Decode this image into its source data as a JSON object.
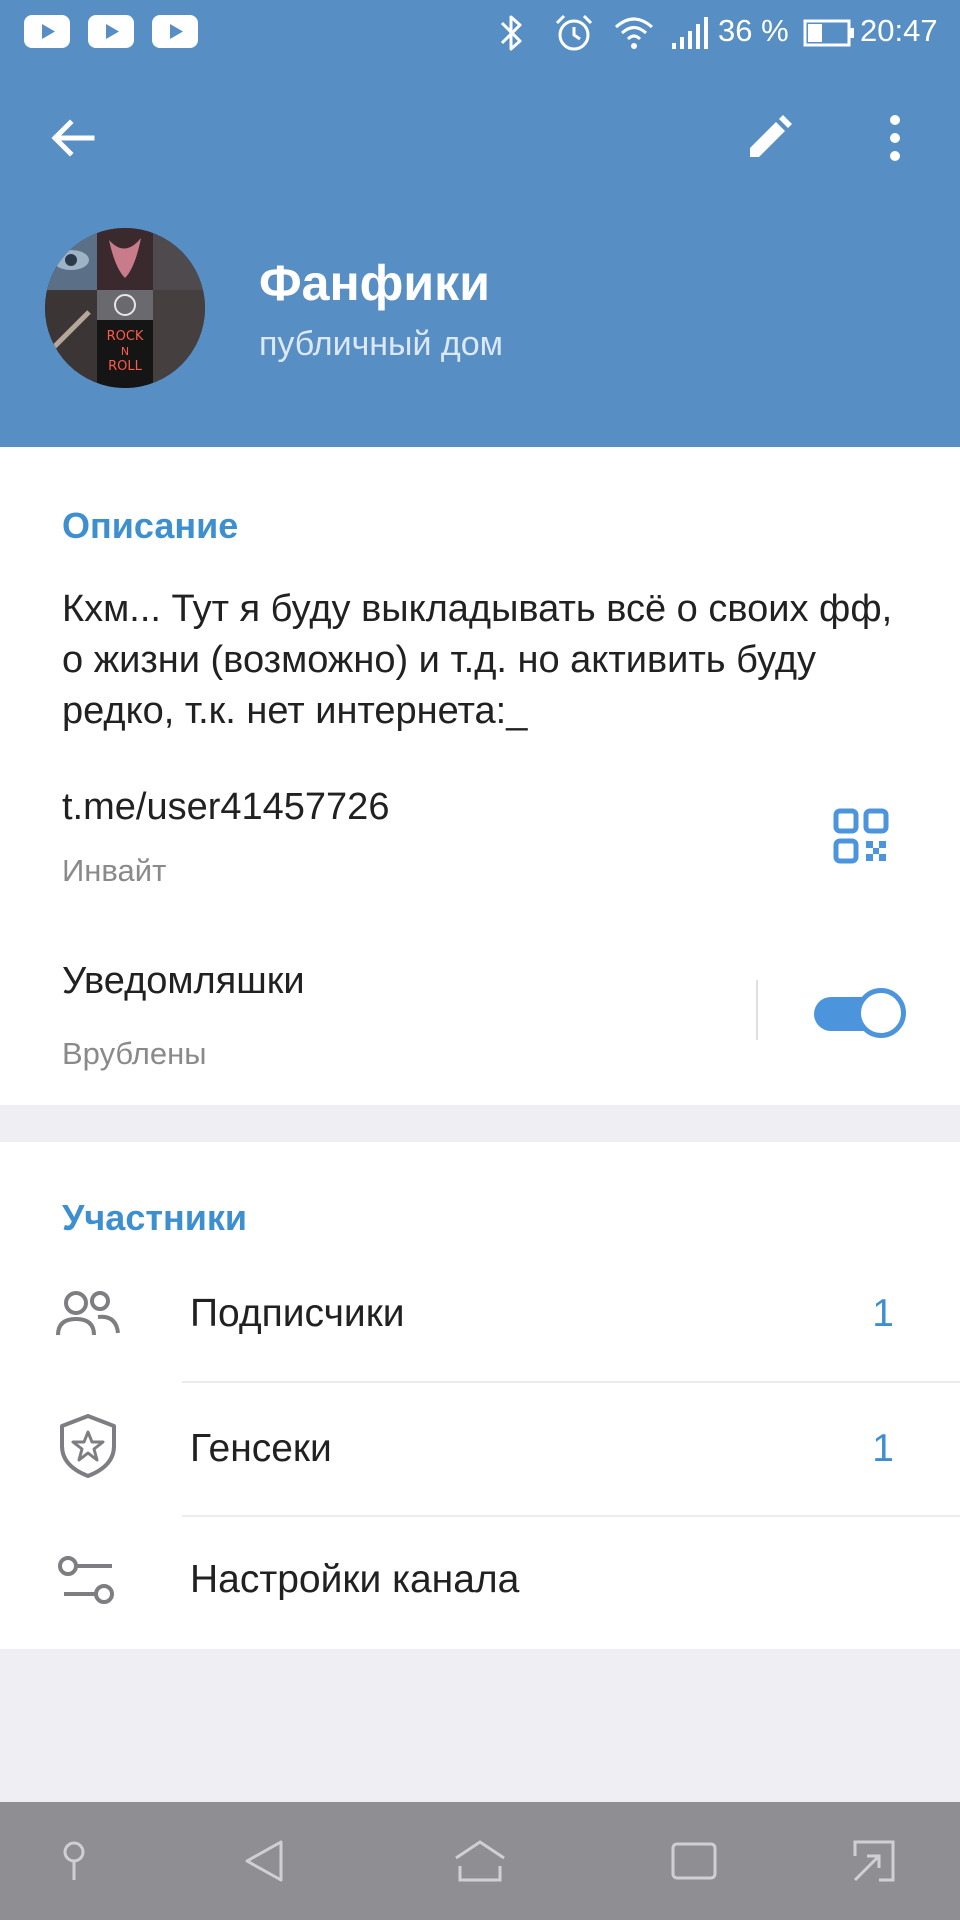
{
  "status_bar": {
    "battery": "36 %",
    "time": "20:47"
  },
  "toolbar": {
    "back_icon": "arrow-left-icon",
    "edit_icon": "pencil-icon",
    "more_icon": "more-vertical-icon"
  },
  "profile": {
    "title": "Фанфики",
    "subtitle": "публичный дом",
    "avatar_text": [
      "ROCK",
      "N",
      "ROLL"
    ]
  },
  "info": {
    "section_title": "Описание",
    "description": "Кхм... Тут я буду выкладывать всё о своих фф, о жизни (возможно) и т.д. но активить буду редко, т.к. нет интернета:_",
    "link": "t.me/user41457726",
    "link_caption": "Инвайт",
    "notifications_label": "Уведомляшки",
    "notifications_status": "Врублены",
    "notifications_enabled": true
  },
  "members": {
    "section_title": "Участники",
    "items": [
      {
        "label": "Подписчики",
        "count": "1",
        "icon": "users-icon"
      },
      {
        "label": "Генсеки",
        "count": "1",
        "icon": "shield-star-icon"
      },
      {
        "label": "Настройки канала",
        "count": "",
        "icon": "sliders-icon"
      }
    ]
  },
  "colors": {
    "header": "#578ec4",
    "accent": "#3d8fd0",
    "toggle": "#4c95dc",
    "navbar": "#8e8e93"
  }
}
